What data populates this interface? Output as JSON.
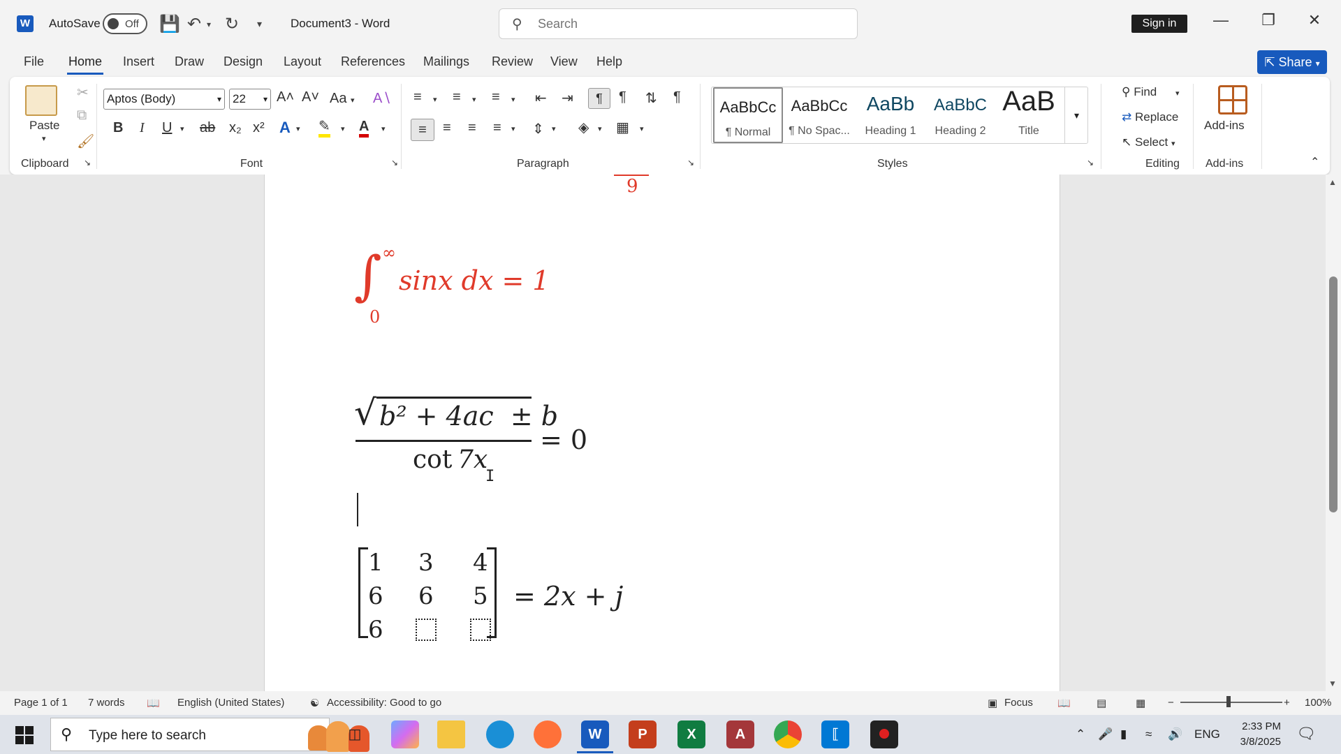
{
  "titlebar": {
    "autosave_label": "AutoSave",
    "autosave_state": "Off",
    "document_title": "Document3  -  Word",
    "search_placeholder": "Search",
    "sign_in": "Sign in"
  },
  "tabs": [
    "File",
    "Home",
    "Insert",
    "Draw",
    "Design",
    "Layout",
    "References",
    "Mailings",
    "Review",
    "View",
    "Help"
  ],
  "active_tab": "Home",
  "share_label": "Share",
  "ribbon": {
    "clipboard": {
      "paste": "Paste",
      "group": "Clipboard"
    },
    "font": {
      "name": "Aptos (Body)",
      "size": "22",
      "group": "Font",
      "grow": "A˄",
      "shrink": "A˅",
      "case": "Aa"
    },
    "paragraph": {
      "group": "Paragraph"
    },
    "styles": {
      "group": "Styles",
      "items": [
        {
          "preview": "AaBbCc",
          "name": "¶ Normal"
        },
        {
          "preview": "AaBbCc",
          "name": "¶ No Spac..."
        },
        {
          "preview": "AaBb",
          "name": "Heading 1"
        },
        {
          "preview": "AaBbC",
          "name": "Heading 2"
        },
        {
          "preview": "AaB",
          "name": "Title"
        }
      ]
    },
    "editing": {
      "find": "Find",
      "replace": "Replace",
      "select": "Select",
      "group": "Editing"
    },
    "addins": {
      "label": "Add-ins",
      "group": "Add-ins"
    }
  },
  "document": {
    "partial_top": "9",
    "eq1": {
      "lower": "0",
      "upper": "∞",
      "body": "sinx dx = 1",
      "color": "#e03a2a"
    },
    "eq2": {
      "numerator": "b² + 4ac  ± b",
      "denominator_fn": "cot",
      "denominator_arg": "7x",
      "rhs": "= 0"
    },
    "eq3": {
      "matrix": [
        [
          "1",
          "3",
          "4"
        ],
        [
          "6",
          "6",
          "5"
        ],
        [
          "6",
          "",
          ""
        ]
      ],
      "rhs": "= 2x + j"
    }
  },
  "status": {
    "page": "Page 1 of 1",
    "words": "7 words",
    "language": "English (United States)",
    "accessibility": "Accessibility: Good to go",
    "focus": "Focus",
    "zoom": "100%"
  },
  "taskbar": {
    "search_placeholder": "Type here to search",
    "tray_lang": "ENG",
    "time": "2:33 PM",
    "date": "3/8/2025"
  }
}
